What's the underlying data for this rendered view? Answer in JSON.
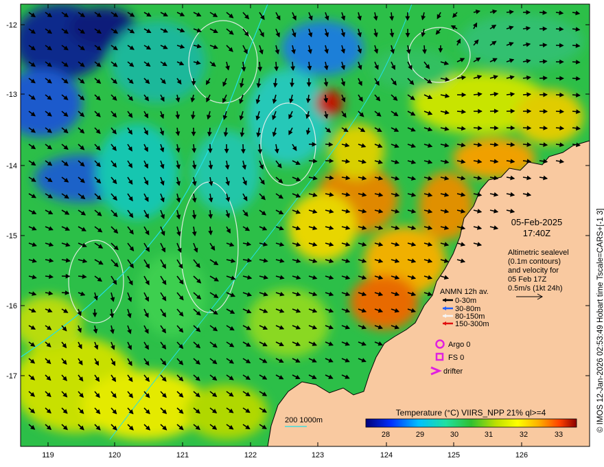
{
  "map": {
    "lat_ticks": [
      "-12",
      "-13",
      "-14",
      "-15",
      "-16",
      "-17"
    ],
    "lon_ticks": [
      "119",
      "120",
      "121",
      "122",
      "123",
      "124",
      "125",
      "126"
    ],
    "date": "05-Feb-2025",
    "time": "17:40Z",
    "altimetry_lines": [
      "Altimetric sealevel",
      "(0.1m contours)",
      "and velocity for",
      "05 Feb 17Z",
      "0.5m/s (1kt 24h)"
    ],
    "credit": "© IMOS 12-Jan-2026 02:53:49 Hobart time Tscale=CARS+[-1 3]",
    "bathy_label": "200  1000m",
    "colorbar": {
      "title": "Temperature (°C) VIIRS_NPP 21% ql>=4",
      "ticks": [
        "28",
        "29",
        "30",
        "31",
        "32",
        "33"
      ]
    },
    "legend": {
      "title": "ANMN 12h av.",
      "items": [
        {
          "label": "0-30m",
          "color": "#000000"
        },
        {
          "label": "30-80m",
          "color": "#1f5fff"
        },
        {
          "label": "80-150m",
          "color": "#f5f5f5"
        },
        {
          "label": "150-300m",
          "color": "#e01010"
        }
      ],
      "argo": "Argo 0",
      "fs": "FS 0",
      "drifter": "drifter"
    },
    "colors": {
      "land": "#f9c9a0",
      "sst_mid": "#2fc04a",
      "marker": "#e020e0"
    }
  }
}
